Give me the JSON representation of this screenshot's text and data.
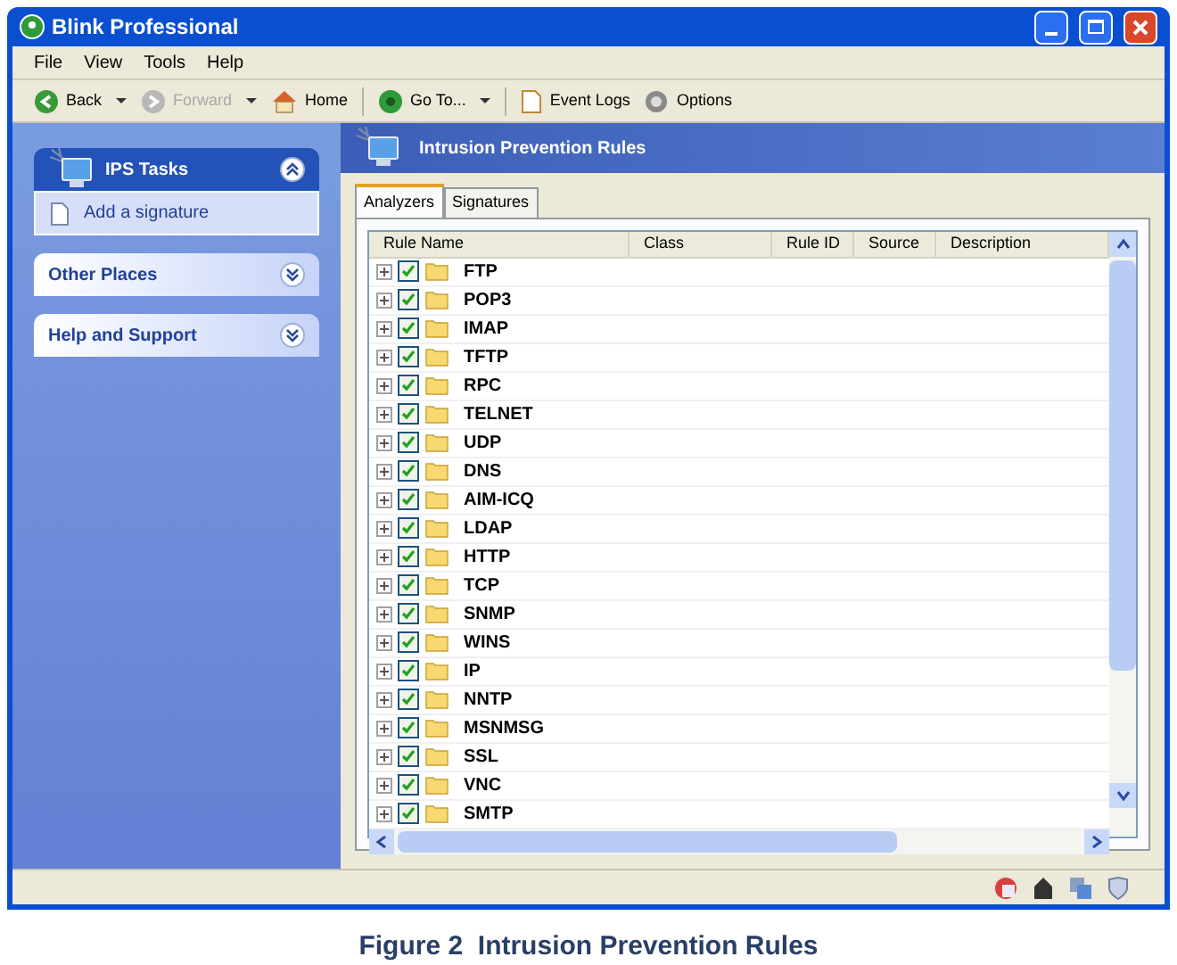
{
  "window": {
    "title": "Blink Professional"
  },
  "menu": [
    "File",
    "View",
    "Tools",
    "Help"
  ],
  "toolbar": [
    {
      "kind": "back",
      "label": "Back",
      "disabled": false
    },
    {
      "kind": "forward",
      "label": "Forward",
      "disabled": true
    },
    {
      "kind": "home",
      "label": "Home",
      "disabled": false
    },
    {
      "kind": "goto",
      "label": "Go To...",
      "disabled": false
    },
    {
      "kind": "logs",
      "label": "Event Logs",
      "disabled": false
    },
    {
      "kind": "options",
      "label": "Options",
      "disabled": false
    }
  ],
  "sidebar": [
    {
      "title": "IPS Tasks",
      "expanded": true,
      "items": [
        "Add a signature"
      ]
    },
    {
      "title": "Other Places",
      "expanded": false
    },
    {
      "title": "Help and Support",
      "expanded": false
    }
  ],
  "panel": {
    "title": "Intrusion Prevention Rules"
  },
  "tabs": [
    {
      "label": "Analyzers",
      "selected": true
    },
    {
      "label": "Signatures",
      "selected": false
    }
  ],
  "table": {
    "columns": [
      "Rule Name",
      "Class",
      "Rule ID",
      "Source",
      "Description"
    ],
    "rows": [
      {
        "name": "FTP",
        "checked": true
      },
      {
        "name": "POP3",
        "checked": true
      },
      {
        "name": "IMAP",
        "checked": true
      },
      {
        "name": "TFTP",
        "checked": true
      },
      {
        "name": "RPC",
        "checked": true
      },
      {
        "name": "TELNET",
        "checked": true
      },
      {
        "name": "UDP",
        "checked": true
      },
      {
        "name": "DNS",
        "checked": true
      },
      {
        "name": "AIM-ICQ",
        "checked": true
      },
      {
        "name": "LDAP",
        "checked": true
      },
      {
        "name": "HTTP",
        "checked": true
      },
      {
        "name": "TCP",
        "checked": true
      },
      {
        "name": "SNMP",
        "checked": true
      },
      {
        "name": "WINS",
        "checked": true
      },
      {
        "name": "IP",
        "checked": true
      },
      {
        "name": "NNTP",
        "checked": true
      },
      {
        "name": "MSNMSG",
        "checked": true
      },
      {
        "name": "SSL",
        "checked": true
      },
      {
        "name": "VNC",
        "checked": true
      },
      {
        "name": "SMTP",
        "checked": true
      }
    ]
  },
  "caption": "Figure 2  Intrusion Prevention Rules"
}
